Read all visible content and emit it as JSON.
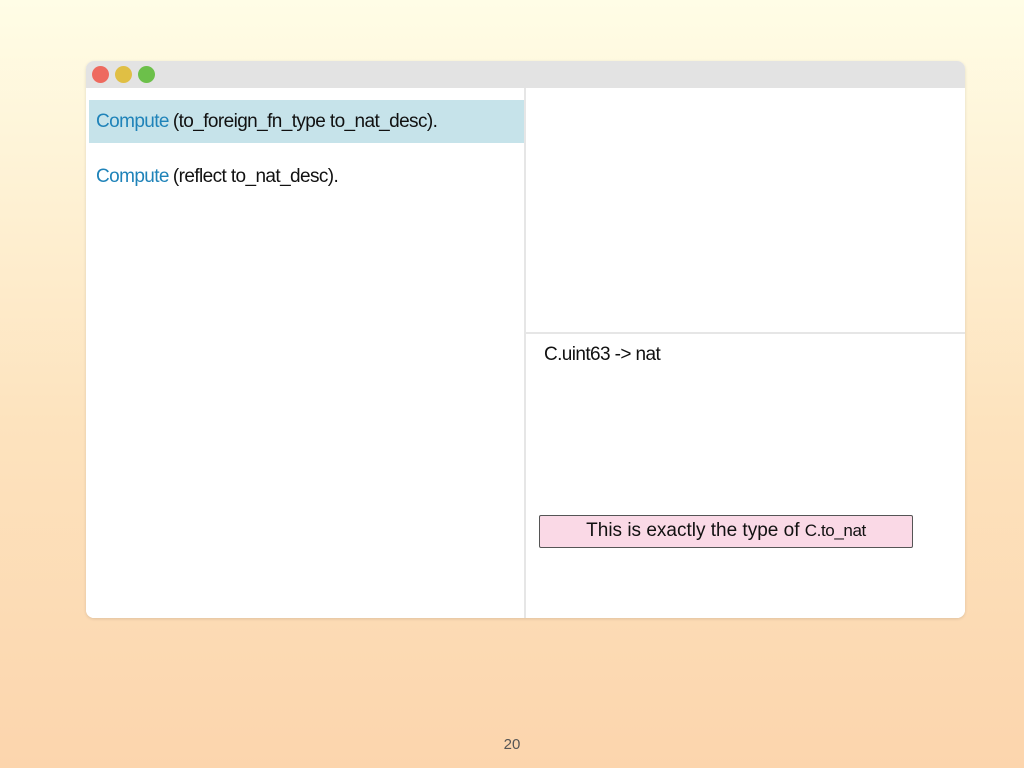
{
  "window": {
    "controls": [
      {
        "name": "close",
        "color": "#ee6a5f"
      },
      {
        "name": "minimize",
        "color": "#e0bf44"
      },
      {
        "name": "maximize",
        "color": "#6cc04a"
      }
    ]
  },
  "editor": {
    "lines": [
      {
        "keyword": "Compute",
        "argument": "(to_foreign_fn_type to_nat_desc).",
        "highlighted": true
      },
      {
        "keyword": "Compute",
        "argument": "(reflect to_nat_desc).",
        "highlighted": false
      }
    ]
  },
  "response": {
    "text": "C.uint63 -> nat"
  },
  "note": {
    "text": "This is exactly the type of",
    "code": "C.to_nat"
  },
  "page_number": "20",
  "colors": {
    "keyword": "#1f83b9",
    "highlight": "#c6e3ea",
    "note_bg": "#fad9e6"
  }
}
